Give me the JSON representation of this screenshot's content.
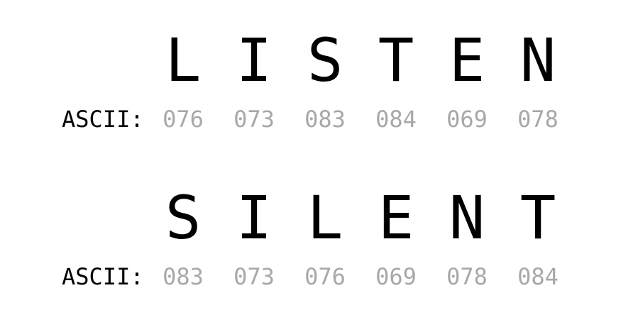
{
  "colors": {
    "letter": "#000000",
    "label": "#000000",
    "code": "#a8a8a8",
    "background": "#ffffff"
  },
  "words": [
    {
      "letters": [
        "L",
        "I",
        "S",
        "T",
        "E",
        "N"
      ],
      "ascii_label": "ASCII:",
      "codes": [
        "076",
        "073",
        "083",
        "084",
        "069",
        "078"
      ]
    },
    {
      "letters": [
        "S",
        "I",
        "L",
        "E",
        "N",
        "T"
      ],
      "ascii_label": "ASCII:",
      "codes": [
        "083",
        "073",
        "076",
        "069",
        "078",
        "084"
      ]
    }
  ]
}
